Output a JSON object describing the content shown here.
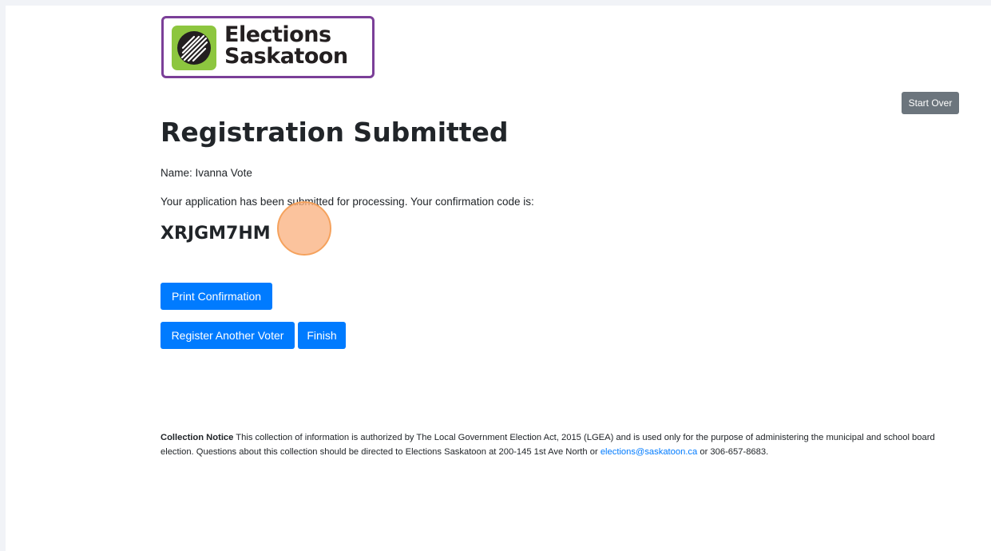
{
  "logo": {
    "line1": "Elections",
    "line2": "Saskatoon"
  },
  "header": {
    "start_over_label": "Start Over"
  },
  "main": {
    "title": "Registration Submitted",
    "name_line": "Name: Ivanna Vote",
    "message": "Your application has been submitted for processing. Your confirmation code is:",
    "confirmation_code": "XRJGM7HM"
  },
  "actions": {
    "print_label": "Print Confirmation",
    "register_another_label": "Register Another Voter",
    "finish_label": "Finish"
  },
  "notice": {
    "heading": "Collection Notice",
    "text_before_email": "This collection of information is authorized by The Local Government Election Act, 2015 (LGEA) and is used only for the purpose of administering the municipal and school board election. Questions about this collection should be directed to Elections Saskatoon at 200-145 1st Ave North or",
    "email": "elections@saskatoon.ca",
    "text_after_email": "or 306-657-8683."
  },
  "colors": {
    "primary": "#007bff",
    "secondary": "#6c757d",
    "logo_border": "#7b3f98",
    "logo_green": "#8dc63f",
    "cursor_highlight": "#f5a25d"
  }
}
